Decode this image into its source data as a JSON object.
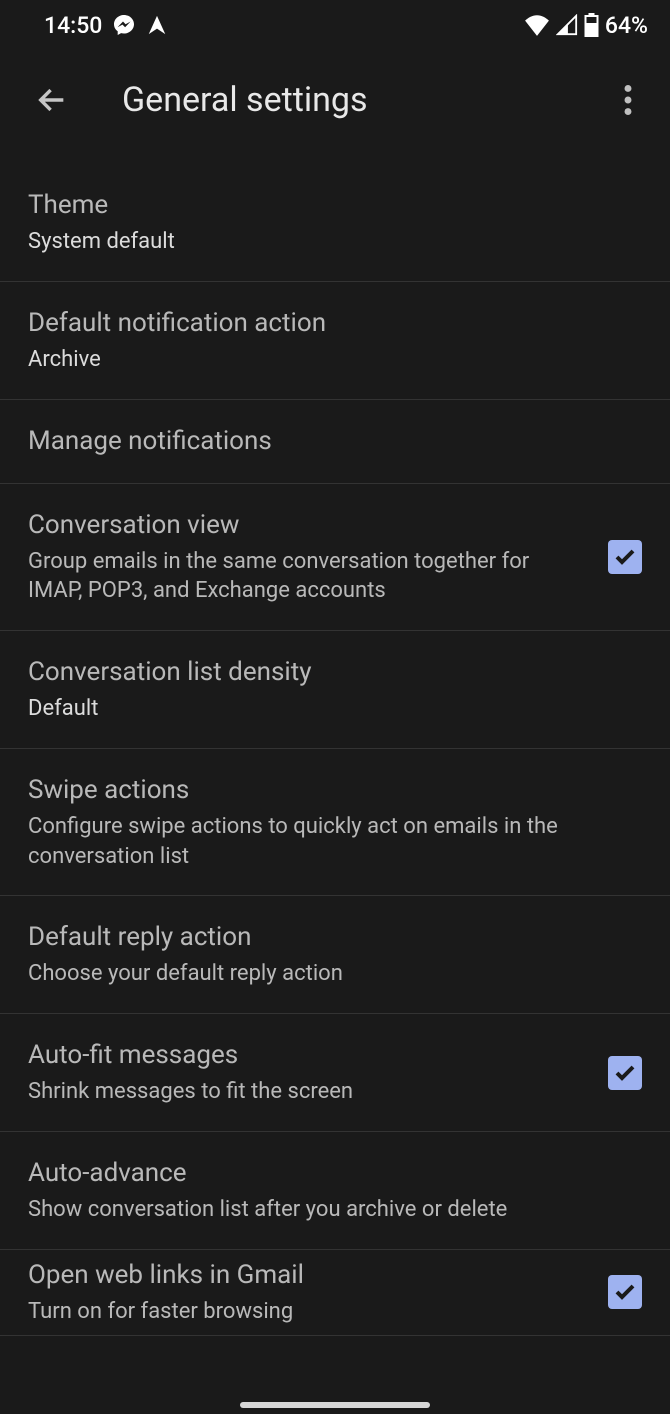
{
  "status": {
    "time": "14:50",
    "battery": "64%",
    "icons": {
      "messenger": "messenger-icon",
      "send": "send-icon",
      "wifi": "wifi-icon",
      "signal": "signal-icon",
      "battery": "battery-icon"
    }
  },
  "header": {
    "title": "General settings"
  },
  "settings": {
    "theme": {
      "title": "Theme",
      "value": "System default"
    },
    "notif_action": {
      "title": "Default notification action",
      "value": "Archive"
    },
    "manage_notif": {
      "title": "Manage notifications"
    },
    "conv_view": {
      "title": "Conversation view",
      "desc": "Group emails in the same conversation together for IMAP, POP3, and Exchange accounts",
      "checked": true
    },
    "density": {
      "title": "Conversation list density",
      "value": "Default"
    },
    "swipe": {
      "title": "Swipe actions",
      "desc": "Configure swipe actions to quickly act on emails in the conversation list"
    },
    "reply": {
      "title": "Default reply action",
      "desc": "Choose your default reply action"
    },
    "autofit": {
      "title": "Auto-fit messages",
      "desc": "Shrink messages to fit the screen",
      "checked": true
    },
    "autoadvance": {
      "title": "Auto-advance",
      "desc": "Show conversation list after you archive or delete"
    },
    "weblinks": {
      "title": "Open web links in Gmail",
      "desc": "Turn on for faster browsing",
      "checked": true
    }
  }
}
